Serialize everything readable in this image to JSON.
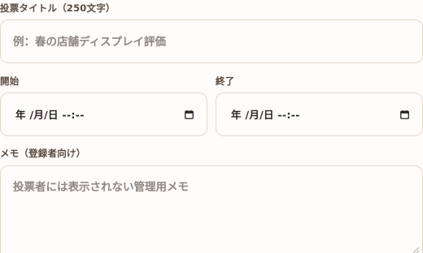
{
  "form": {
    "title": {
      "label": "投票タイトル（250文字）",
      "placeholder": "例：春の店舗ディスプレイ評価"
    },
    "start": {
      "label": "開始",
      "value": "年 /月/日 --:--"
    },
    "end": {
      "label": "終了",
      "value": "年 /月/日 --:--"
    },
    "memo": {
      "label": "メモ（登録者向け）",
      "placeholder": "投票者には表示されない管理用メモ"
    }
  },
  "icons": {
    "calendar": "calendar-icon",
    "resize": "resize-handle-icon"
  }
}
